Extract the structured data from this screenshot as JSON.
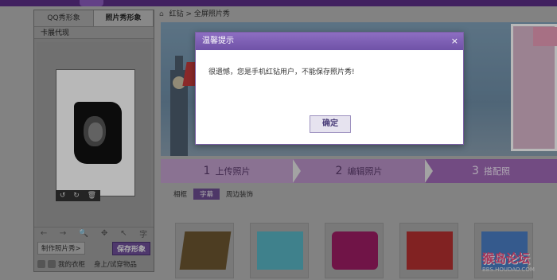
{
  "header": {
    "icons": [
      "menu-notch"
    ]
  },
  "left_panel": {
    "tabs": [
      "QQ秀形象",
      "照片秀形象"
    ],
    "active_tab": 1,
    "subtitle": "卡展代现",
    "mini_tools": [
      "↺",
      "↻",
      "🗑"
    ],
    "toolbar_icons": [
      "←",
      "→",
      "🔍",
      "✥",
      "↖",
      "字"
    ],
    "make_button": "制作照片秀>",
    "save_button": "保存形象",
    "bottom_links": [
      "我的衣柜",
      "身上/试穿物品"
    ]
  },
  "breadcrumb": {
    "root": "红钻",
    "current": "全屏照片秀"
  },
  "steps": [
    {
      "num": "1",
      "label": "上传照片"
    },
    {
      "num": "2",
      "label": "编辑照片"
    },
    {
      "num": "3",
      "label": "搭配照"
    }
  ],
  "filters": [
    "相框",
    "字幕",
    "周边装饰"
  ],
  "active_filter": 1,
  "watermark": {
    "main": "猴岛论坛",
    "sub": "BBS.HOUDAO.COM"
  },
  "dialog": {
    "title": "温馨提示",
    "close": "×",
    "message": "很遗憾，您是手机红钻用户，不能保存照片秀!",
    "ok": "确定"
  },
  "colors": {
    "purple_dark": "#5b2f86",
    "purple_step": "#9f69b4",
    "dialog_header": "#7a5bb3"
  }
}
